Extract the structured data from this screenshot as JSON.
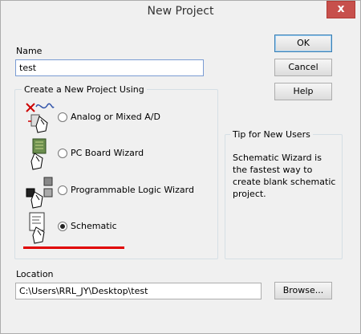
{
  "window": {
    "title": "New Project",
    "close_glyph": "x"
  },
  "name_field": {
    "label": "Name",
    "value": "test"
  },
  "buttons": {
    "ok": "OK",
    "cancel": "Cancel",
    "help": "Help",
    "browse": "Browse..."
  },
  "create_group": {
    "title": "Create a New Project Using",
    "options": [
      {
        "label": "Analog or Mixed A/D",
        "checked": false,
        "icon": "analog-wizard-icon"
      },
      {
        "label": "PC Board Wizard",
        "checked": false,
        "icon": "pcb-wizard-icon"
      },
      {
        "label": "Programmable Logic Wizard",
        "checked": false,
        "icon": "programmable-logic-icon"
      },
      {
        "label": "Schematic",
        "checked": true,
        "icon": "schematic-icon"
      }
    ]
  },
  "tip": {
    "title": "Tip for New Users",
    "text": "Schematic Wizard is the fastest way to create blank schematic project."
  },
  "location": {
    "label": "Location",
    "value": "C:\\Users\\RRL_JY\\Desktop\\test"
  },
  "colors": {
    "accent": "#e00000",
    "title_bg": "#f0f0f0",
    "close": "#c7504c"
  }
}
